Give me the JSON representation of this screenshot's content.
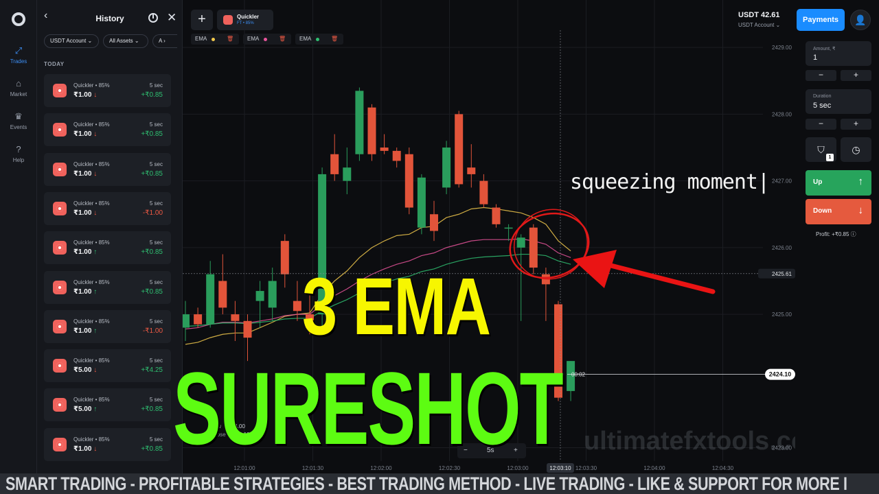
{
  "nav": {
    "items": [
      {
        "label": "Trades",
        "icon": "trades-icon",
        "active": true
      },
      {
        "label": "Market",
        "icon": "market-icon",
        "active": false
      },
      {
        "label": "Events",
        "icon": "trophy-icon",
        "active": false
      },
      {
        "label": "Help",
        "icon": "help-icon",
        "active": false
      }
    ]
  },
  "history": {
    "title": "History",
    "filters": [
      "USDT Account",
      "All Assets",
      "A"
    ],
    "section": "TODAY",
    "trades": [
      {
        "name": "Quickler • 85%",
        "duration": "5 sec",
        "amount": "₹1.00",
        "dir": "↓",
        "dir_class": "dn",
        "profit": "+₹0.85",
        "neg": false
      },
      {
        "name": "Quickler • 85%",
        "duration": "5 sec",
        "amount": "₹1.00",
        "dir": "↓",
        "dir_class": "dn",
        "profit": "+₹0.85",
        "neg": false
      },
      {
        "name": "Quickler • 85%",
        "duration": "5 sec",
        "amount": "₹1.00",
        "dir": "↓",
        "dir_class": "dn",
        "profit": "+₹0.85",
        "neg": false
      },
      {
        "name": "Quickler • 85%",
        "duration": "5 sec",
        "amount": "₹1.00",
        "dir": "↓",
        "dir_class": "dn",
        "profit": "-₹1.00",
        "neg": true
      },
      {
        "name": "Quickler • 85%",
        "duration": "5 sec",
        "amount": "₹1.00",
        "dir": "↑",
        "dir_class": "up",
        "profit": "+₹0.85",
        "neg": false
      },
      {
        "name": "Quickler • 85%",
        "duration": "5 sec",
        "amount": "₹1.00",
        "dir": "↑",
        "dir_class": "up",
        "profit": "+₹0.85",
        "neg": false
      },
      {
        "name": "Quickler • 85%",
        "duration": "5 sec",
        "amount": "₹1.00",
        "dir": "↑",
        "dir_class": "up",
        "profit": "-₹1.00",
        "neg": true
      },
      {
        "name": "Quickler • 85%",
        "duration": "5 sec",
        "amount": "₹5.00",
        "dir": "↓",
        "dir_class": "dn",
        "profit": "+₹4.25",
        "neg": false
      },
      {
        "name": "Quickler • 85%",
        "duration": "5 sec",
        "amount": "₹5.00",
        "dir": "↑",
        "dir_class": "up",
        "profit": "+₹0.85",
        "neg": false
      },
      {
        "name": "Quickler • 85%",
        "duration": "5 sec",
        "amount": "₹1.00",
        "dir": "↓",
        "dir_class": "dn",
        "profit": "+₹0.85",
        "neg": false
      }
    ]
  },
  "asset": {
    "name": "Quickler",
    "sub": "FT • 85%"
  },
  "indicators": [
    {
      "label": "EMA",
      "color": "#f2c94c"
    },
    {
      "label": "EMA",
      "color": "#e9559b"
    },
    {
      "label": "EMA",
      "color": "#2fbf71"
    }
  ],
  "ohlc": {
    "rows": [
      {
        "label": "low",
        "value": "2424.00"
      },
      {
        "label": "close",
        "value": "2424.10"
      }
    ]
  },
  "zoom": {
    "minus": "−",
    "value": "5s",
    "plus": "+"
  },
  "chart_data": {
    "type": "candlestick",
    "ylim": [
      2422.8,
      2429.3
    ],
    "y_ticks": [
      "2429.00",
      "2428.00",
      "2427.00",
      "2426.00",
      "2425.00",
      "2423.00"
    ],
    "x_ticks": [
      "12:01:00",
      "12:01:30",
      "12:02:00",
      "12:02:30",
      "12:03:00",
      "12:03:30",
      "12:04:00",
      "12:04:30"
    ],
    "current_price": "2424.10",
    "countdown": "00:02",
    "crosshair_price": "2425.61",
    "crosshair_time": "12:03:10",
    "candles": [
      {
        "o": 2424.8,
        "h": 2425.2,
        "l": 2424.6,
        "c": 2425.0
      },
      {
        "o": 2425.0,
        "h": 2425.1,
        "l": 2424.8,
        "c": 2424.85
      },
      {
        "o": 2424.85,
        "h": 2425.8,
        "l": 2424.8,
        "c": 2425.6
      },
      {
        "o": 2425.5,
        "h": 2425.9,
        "l": 2425.0,
        "c": 2425.1
      },
      {
        "o": 2425.0,
        "h": 2425.2,
        "l": 2424.6,
        "c": 2424.9
      },
      {
        "o": 2424.9,
        "h": 2425.0,
        "l": 2424.3,
        "c": 2424.65
      },
      {
        "o": 2425.2,
        "h": 2425.5,
        "l": 2424.8,
        "c": 2425.35
      },
      {
        "o": 2425.1,
        "h": 2425.7,
        "l": 2424.9,
        "c": 2425.5
      },
      {
        "o": 2426.1,
        "h": 2426.2,
        "l": 2425.4,
        "c": 2425.6
      },
      {
        "o": 2425.2,
        "h": 2425.5,
        "l": 2424.9,
        "c": 2425.05
      },
      {
        "o": 2425.0,
        "h": 2425.3,
        "l": 2424.7,
        "c": 2424.8
      },
      {
        "o": 2425.0,
        "h": 2427.2,
        "l": 2424.8,
        "c": 2427.1
      },
      {
        "o": 2427.4,
        "h": 2427.7,
        "l": 2427.0,
        "c": 2427.1
      },
      {
        "o": 2427.0,
        "h": 2427.5,
        "l": 2426.8,
        "c": 2427.2
      },
      {
        "o": 2427.4,
        "h": 2428.4,
        "l": 2427.3,
        "c": 2428.35
      },
      {
        "o": 2428.1,
        "h": 2428.15,
        "l": 2427.3,
        "c": 2427.4
      },
      {
        "o": 2427.5,
        "h": 2427.7,
        "l": 2427.4,
        "c": 2427.45
      },
      {
        "o": 2427.45,
        "h": 2427.5,
        "l": 2427.2,
        "c": 2427.3
      },
      {
        "o": 2427.4,
        "h": 2427.5,
        "l": 2426.5,
        "c": 2426.6
      },
      {
        "o": 2426.3,
        "h": 2427.1,
        "l": 2426.2,
        "c": 2427.05
      },
      {
        "o": 2426.5,
        "h": 2426.7,
        "l": 2426.1,
        "c": 2426.25
      },
      {
        "o": 2426.9,
        "h": 2427.6,
        "l": 2426.8,
        "c": 2427.5
      },
      {
        "o": 2428.0,
        "h": 2428.05,
        "l": 2426.9,
        "c": 2426.95
      },
      {
        "o": 2427.2,
        "h": 2427.55,
        "l": 2426.9,
        "c": 2427.1
      },
      {
        "o": 2427.0,
        "h": 2427.1,
        "l": 2426.6,
        "c": 2426.65
      },
      {
        "o": 2426.6,
        "h": 2426.65,
        "l": 2426.3,
        "c": 2426.35
      },
      {
        "o": 2426.3,
        "h": 2426.35,
        "l": 2426.1,
        "c": 2426.3
      },
      {
        "o": 2426.0,
        "h": 2426.2,
        "l": 2424.9,
        "c": 2426.15
      },
      {
        "o": 2426.3,
        "h": 2426.35,
        "l": 2425.6,
        "c": 2425.7
      },
      {
        "o": 2425.6,
        "h": 2425.7,
        "l": 2424.9,
        "c": 2425.45
      },
      {
        "o": 2425.15,
        "h": 2425.2,
        "l": 2423.7,
        "c": 2423.75
      },
      {
        "o": 2423.85,
        "h": 2424.3,
        "l": 2423.7,
        "c": 2424.3
      }
    ],
    "ema": [
      {
        "name": "EMA",
        "color": "#f2c94c",
        "values": [
          2424.55,
          2424.58,
          2424.65,
          2424.7,
          2424.72,
          2424.72,
          2424.8,
          2424.88,
          2424.97,
          2425.0,
          2425.02,
          2425.3,
          2425.5,
          2425.65,
          2425.85,
          2426.0,
          2426.1,
          2426.18,
          2426.2,
          2426.3,
          2426.32,
          2426.45,
          2426.5,
          2426.58,
          2426.6,
          2426.58,
          2426.55,
          2426.52,
          2426.45,
          2426.35,
          2426.1,
          2425.95
        ]
      },
      {
        "name": "EMA",
        "color": "#e9559b",
        "values": [
          2424.78,
          2424.8,
          2424.85,
          2424.88,
          2424.88,
          2424.87,
          2424.9,
          2424.93,
          2424.98,
          2425.0,
          2425.0,
          2425.15,
          2425.28,
          2425.38,
          2425.5,
          2425.6,
          2425.68,
          2425.75,
          2425.8,
          2425.88,
          2425.92,
          2426.0,
          2426.05,
          2426.1,
          2426.12,
          2426.12,
          2426.12,
          2426.13,
          2426.1,
          2426.05,
          2425.92,
          2425.85
        ]
      },
      {
        "name": "EMA",
        "color": "#2fbf71",
        "values": [
          2424.82,
          2424.83,
          2424.85,
          2424.87,
          2424.87,
          2424.86,
          2424.88,
          2424.9,
          2424.93,
          2424.94,
          2424.94,
          2425.05,
          2425.14,
          2425.22,
          2425.32,
          2425.4,
          2425.47,
          2425.53,
          2425.57,
          2425.64,
          2425.68,
          2425.75,
          2425.8,
          2425.84,
          2425.86,
          2425.87,
          2425.88,
          2425.9,
          2425.9,
          2425.88,
          2425.8,
          2425.75
        ]
      }
    ]
  },
  "overlay": {
    "annotation": "squeezing moment|",
    "headline1": "3 EMA",
    "headline2": "SURESHOT",
    "watermark": "ultimatefxtools.com"
  },
  "account": {
    "balance": "USDT 42.61",
    "account": "USDT Account ⌄",
    "payments": "Payments"
  },
  "order": {
    "amount_label": "Amount, ₹",
    "amount": "1",
    "duration_label": "Duration",
    "duration": "5 sec",
    "minus": "−",
    "plus": "+",
    "badge": "1",
    "up": "Up",
    "down": "Down",
    "profit": "Profit: +₹0.85 ⓘ"
  },
  "ticker": "SMART TRADING - PROFITABLE STRATEGIES - BEST TRADING METHOD - LIVE TRADING - LIKE & SUPPORT FOR MORE I"
}
